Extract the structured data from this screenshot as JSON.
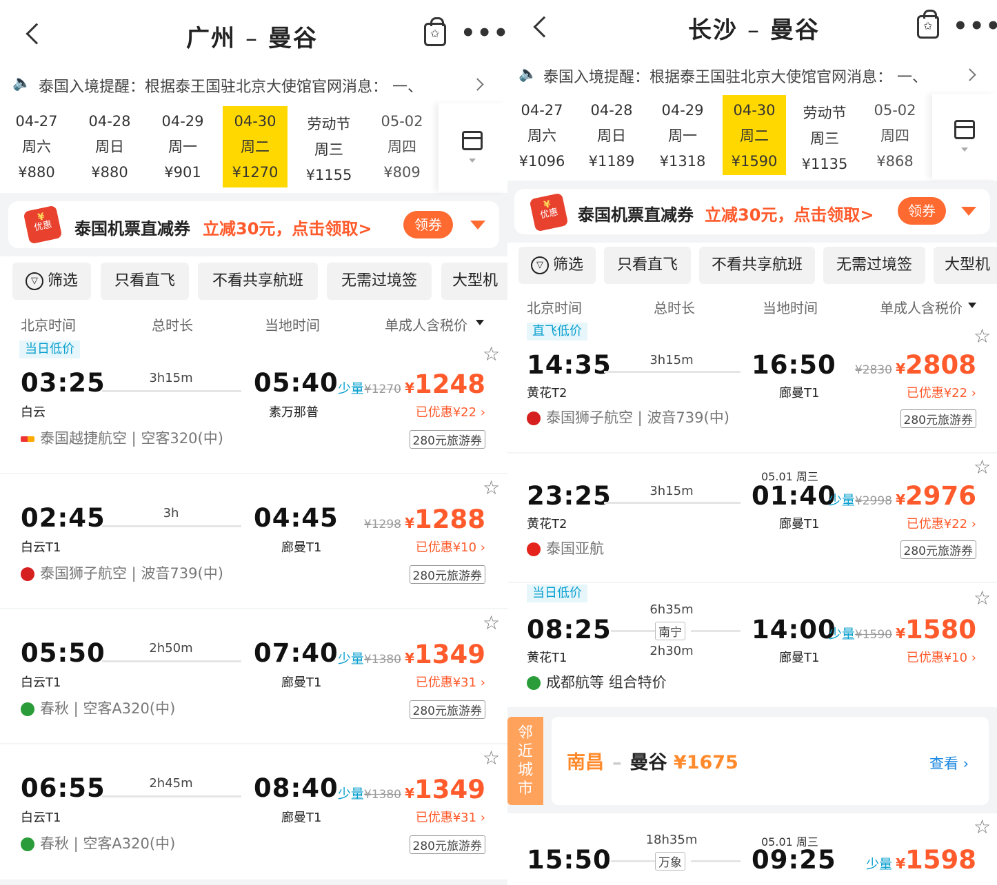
{
  "left": {
    "route_from": "广州",
    "route_to": "曼谷",
    "notice": "泰国入境提醒：根据泰王国驻北京大使馆官网消息：  一、",
    "dates": [
      {
        "date": "04-27",
        "day": "周六",
        "price": "¥880"
      },
      {
        "date": "04-28",
        "day": "周日",
        "price": "¥880"
      },
      {
        "date": "04-29",
        "day": "周一",
        "price": "¥901"
      },
      {
        "date": "04-30",
        "day": "周二",
        "price": "¥1270"
      },
      {
        "date": "劳动节",
        "day": "周三",
        "price": "¥1155"
      },
      {
        "date": "05-02",
        "day": "周四",
        "price": "¥809"
      }
    ],
    "banner": {
      "title": "泰国机票直减券",
      "promo": "立减30元，点击领取>",
      "button": "领券",
      "icon_top": "¥",
      "icon_bottom": "优惠"
    },
    "filters": [
      "筛选",
      "只看直飞",
      "不看共享航班",
      "无需过境签",
      "大型机"
    ],
    "columns": [
      "北京时间",
      "总时长",
      "当地时间",
      "单成人含税价"
    ],
    "flights": [
      {
        "tag": "当日低价",
        "dep": "03:25",
        "dep_ap": "白云",
        "dur": "3h15m",
        "arr": "05:40",
        "arr_ap": "素万那普",
        "few": "少量",
        "old": "¥1270",
        "price": "1248",
        "disc": "已优惠¥22",
        "voucher": "280元旅游券",
        "airline": "泰国越捷航空",
        "plane": "空客320(中)"
      },
      {
        "tag": "",
        "dep": "02:45",
        "dep_ap": "白云T1",
        "dur": "3h",
        "arr": "04:45",
        "arr_ap": "廊曼T1",
        "few": "",
        "old": "¥1298",
        "price": "1288",
        "disc": "已优惠¥10",
        "voucher": "280元旅游券",
        "airline": "泰国狮子航空",
        "plane": "波音739(中)"
      },
      {
        "tag": "",
        "dep": "05:50",
        "dep_ap": "白云T1",
        "dur": "2h50m",
        "arr": "07:40",
        "arr_ap": "廊曼T1",
        "few": "少量",
        "old": "¥1380",
        "price": "1349",
        "disc": "已优惠¥31",
        "voucher": "280元旅游券",
        "airline": "春秋",
        "plane": "空客A320(中)"
      },
      {
        "tag": "",
        "dep": "06:55",
        "dep_ap": "白云T1",
        "dur": "2h45m",
        "arr": "08:40",
        "arr_ap": "廊曼T1",
        "few": "少量",
        "old": "¥1380",
        "price": "1349",
        "disc": "已优惠¥31",
        "voucher": "280元旅游券",
        "airline": "春秋",
        "plane": "空客A320(中)"
      }
    ]
  },
  "right": {
    "route_from": "长沙",
    "route_to": "曼谷",
    "notice": "泰国入境提醒：根据泰王国驻北京大使馆官网消息：  一、",
    "dates": [
      {
        "date": "04-27",
        "day": "周六",
        "price": "¥1096"
      },
      {
        "date": "04-28",
        "day": "周日",
        "price": "¥1189"
      },
      {
        "date": "04-29",
        "day": "周一",
        "price": "¥1318"
      },
      {
        "date": "04-30",
        "day": "周二",
        "price": "¥1590"
      },
      {
        "date": "劳动节",
        "day": "周三",
        "price": "¥1135"
      },
      {
        "date": "05-02",
        "day": "周四",
        "price": "¥868"
      }
    ],
    "banner": {
      "title": "泰国机票直减券",
      "promo": "立减30元，点击领取>",
      "button": "领券",
      "icon_top": "¥",
      "icon_bottom": "优惠"
    },
    "filters": [
      "筛选",
      "只看直飞",
      "不看共享航班",
      "无需过境签",
      "大型机"
    ],
    "columns": [
      "北京时间",
      "总时长",
      "当地时间",
      "单成人含税价"
    ],
    "flights": [
      {
        "tag": "直飞低价",
        "dep": "14:35",
        "dep_ap": "黄花T2",
        "dur": "3h15m",
        "arr": "16:50",
        "arr_ap": "廊曼T1",
        "next": "",
        "few": "",
        "old": "¥2830",
        "price": "2808",
        "disc": "已优惠¥22",
        "voucher": "280元旅游券",
        "airline": "泰国狮子航空",
        "plane": "波音739(中)"
      },
      {
        "tag": "",
        "dep": "23:25",
        "dep_ap": "黄花T2",
        "dur": "3h15m",
        "arr": "01:40",
        "arr_ap": "廊曼T1",
        "next": "05.01 周三",
        "few": "少量",
        "old": "¥2998",
        "price": "2976",
        "disc": "已优惠¥22",
        "voucher": "280元旅游券",
        "airline": "泰国亚航",
        "plane": ""
      },
      {
        "tag": "当日低价",
        "dep": "08:25",
        "dep_ap": "黄花T1",
        "dur": "6h35m",
        "via": "南宁",
        "dur2": "2h30m",
        "arr": "14:00",
        "arr_ap": "廊曼T1",
        "next": "",
        "few": "少量",
        "old": "¥1590",
        "price": "1580",
        "disc": "已优惠¥10",
        "voucher": "",
        "airline": "成都航等",
        "plane": "组合特价"
      },
      {
        "tag": "",
        "dep": "15:50",
        "dep_ap": "",
        "dur": "18h35m",
        "via": "万象",
        "arr": "09:25",
        "arr_ap": "",
        "next": "05.01 周三",
        "few": "少量",
        "old": "",
        "price": "1598",
        "disc": "",
        "voucher": "",
        "airline": "",
        "plane": ""
      }
    ],
    "nearby": {
      "side": "邻近城市",
      "from": "南昌",
      "to": "曼谷",
      "price": "¥1675",
      "link": "查看"
    }
  },
  "colors": {
    "accent": "#ff5a2b",
    "selected_date": "#ffd800",
    "few_seats": "#0aa0cf",
    "nearby": "#ffa25c"
  }
}
